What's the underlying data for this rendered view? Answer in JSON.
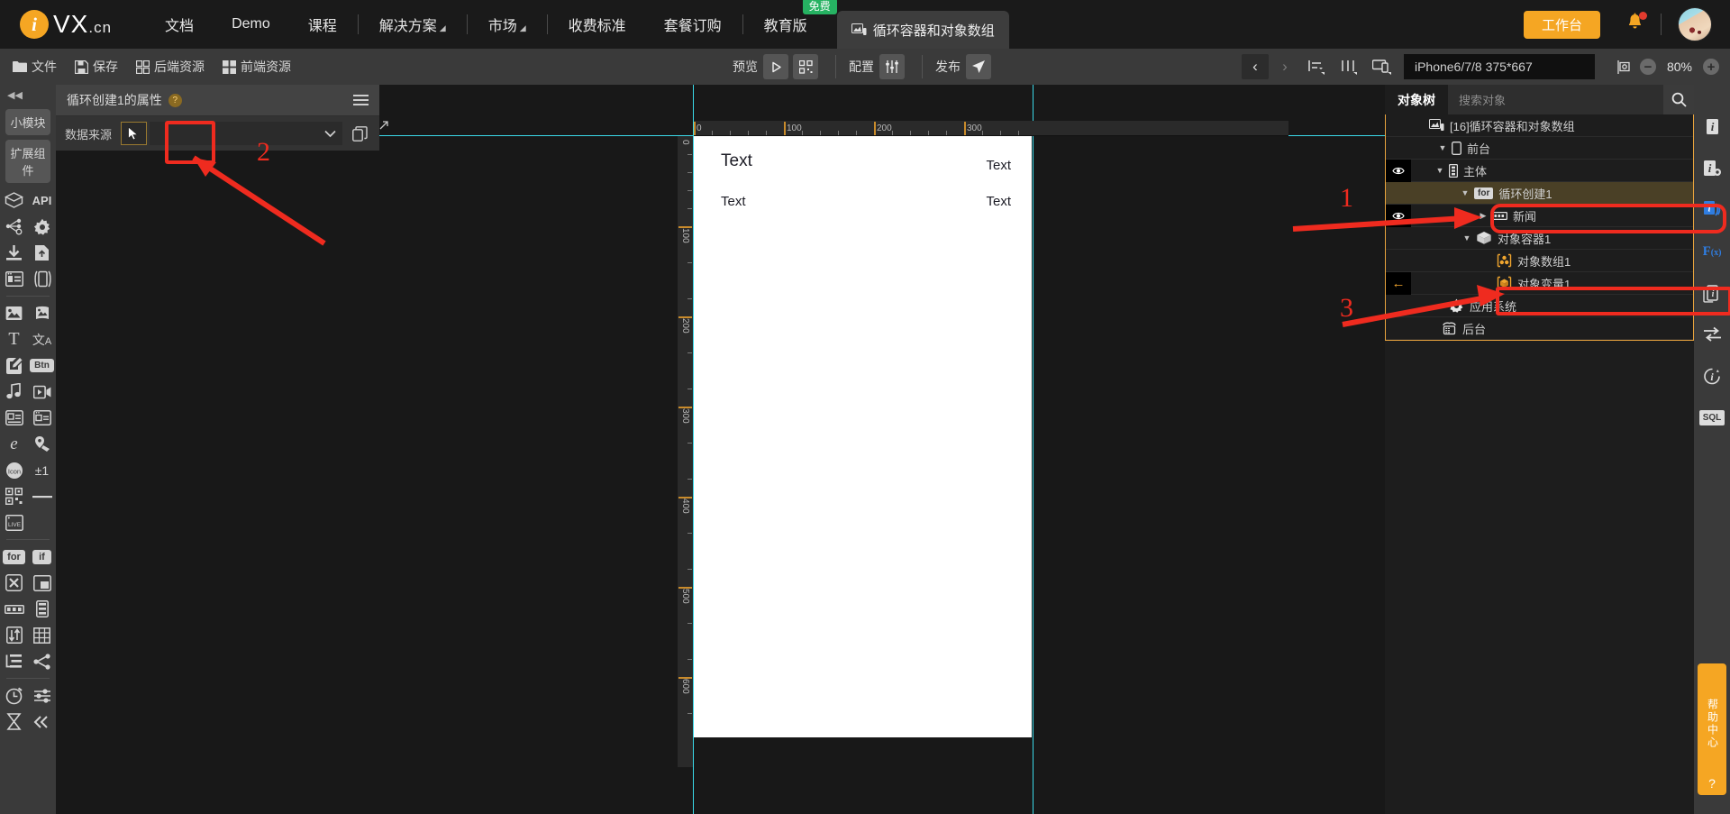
{
  "topnav": {
    "logo_mark": "i",
    "logo_name": "VX",
    "logo_suffix": ".cn",
    "items": [
      {
        "label": "文档",
        "caret": false,
        "badge": null
      },
      {
        "label": "Demo",
        "caret": false,
        "badge": null
      },
      {
        "label": "课程",
        "caret": false,
        "badge": null
      },
      {
        "label": "解决方案",
        "caret": true,
        "badge": null
      },
      {
        "label": "市场",
        "caret": true,
        "badge": null
      },
      {
        "label": "收费标准",
        "caret": false,
        "badge": null
      },
      {
        "label": "套餐订购",
        "caret": false,
        "badge": null
      },
      {
        "label": "教育版",
        "caret": false,
        "badge": "免费"
      }
    ],
    "project_tab": "循环容器和对象数组",
    "workbench_label": "工作台"
  },
  "toolbar": {
    "file_label": "文件",
    "save_label": "保存",
    "backend_res_label": "后端资源",
    "frontend_res_label": "前端资源",
    "preview_label": "预览",
    "config_label": "配置",
    "publish_label": "发布",
    "device": "iPhone6/7/8 375*667",
    "zoom": "80%"
  },
  "left_rail": {
    "collapse_icon": "double-left-arrow",
    "tags": [
      "小模块",
      "扩展组件"
    ],
    "groups": [
      {
        "icons": [
          {
            "name": "api-box-icon",
            "glyph": "box"
          },
          {
            "name": "api-text-icon",
            "glyph": "API"
          },
          {
            "name": "node-graph-icon",
            "glyph": "nodes"
          },
          {
            "name": "gear-icon",
            "glyph": "gear"
          },
          {
            "name": "download-icon",
            "glyph": "download"
          },
          {
            "name": "file-upload-icon",
            "glyph": "file-up"
          },
          {
            "name": "card-layout-icon",
            "glyph": "card"
          },
          {
            "name": "mobile-frame-icon",
            "glyph": "mobile"
          }
        ]
      },
      {
        "icons": [
          {
            "name": "image-icon",
            "glyph": "image"
          },
          {
            "name": "image-stack-icon",
            "glyph": "images"
          },
          {
            "name": "text-icon",
            "glyph": "T"
          },
          {
            "name": "translate-icon",
            "glyph": "文A"
          },
          {
            "name": "edit-icon",
            "glyph": "pencil"
          },
          {
            "name": "button-icon",
            "glyph": "Btn"
          },
          {
            "name": "audio-icon",
            "glyph": "note"
          },
          {
            "name": "video-icon",
            "glyph": "video"
          },
          {
            "name": "richtext-icon",
            "glyph": "a-list"
          },
          {
            "name": "article-icon",
            "glyph": "a-list2"
          },
          {
            "name": "browser-icon",
            "glyph": "e"
          },
          {
            "name": "map-icon",
            "glyph": "map-pin"
          },
          {
            "name": "icon-library-icon",
            "glyph": "Icon"
          },
          {
            "name": "plusminus-icon",
            "glyph": "±1"
          },
          {
            "name": "qrcode-icon",
            "glyph": "qr"
          },
          {
            "name": "line-icon",
            "glyph": "line"
          },
          {
            "name": "live-icon",
            "glyph": "LIVE"
          }
        ]
      },
      {
        "icons": [
          {
            "name": "for-loop-icon",
            "glyph": "for"
          },
          {
            "name": "if-condition-icon",
            "glyph": "if"
          },
          {
            "name": "shuffle-icon",
            "glyph": "shuffle"
          },
          {
            "name": "container-icon",
            "glyph": "container"
          },
          {
            "name": "slider-icon",
            "glyph": "slider"
          },
          {
            "name": "list-icon",
            "glyph": "list"
          },
          {
            "name": "sort-icon",
            "glyph": "sort"
          },
          {
            "name": "table-icon",
            "glyph": "table"
          },
          {
            "name": "tree-icon",
            "glyph": "tree"
          },
          {
            "name": "share-node-icon",
            "glyph": "share"
          }
        ]
      },
      {
        "icons": [
          {
            "name": "timer-icon",
            "glyph": "clock"
          },
          {
            "name": "settings-slider-icon",
            "glyph": "sliders"
          },
          {
            "name": "hourglass-icon",
            "glyph": "hourglass"
          },
          {
            "name": "collapse-left-icon",
            "glyph": "chevrons"
          }
        ]
      }
    ]
  },
  "properties": {
    "title": "循环创建1的属性",
    "help_icon": "?",
    "menu_icon": "hamburger-icon",
    "data_source_label": "数据来源",
    "data_source_value": "",
    "cursor_icon": "cursor-arrow-icon",
    "dropdown_icon": "chevron-down-icon",
    "copy_icon": "copy-icon"
  },
  "canvas": {
    "ruler_h_labels": [
      "0",
      "100",
      "200",
      "300"
    ],
    "ruler_v_labels": [
      "0",
      "100",
      "200",
      "300",
      "400",
      "500",
      "600"
    ],
    "phone_texts": [
      "Text",
      "Text",
      "Text",
      "Text"
    ]
  },
  "tree": {
    "tab_label": "对象树",
    "search_placeholder": "搜索对象",
    "search_icon": "search-icon",
    "nodes": [
      {
        "label": "[16]循环容器和对象数组",
        "indent": 0,
        "icon": "app-screen-icon",
        "eye": false,
        "twisty": "",
        "selected": false,
        "highlight": false
      },
      {
        "label": "前台",
        "indent": 1,
        "icon": "phone-icon",
        "eye": false,
        "twisty": "down",
        "selected": false,
        "highlight": false
      },
      {
        "label": "主体",
        "indent": 2,
        "icon": "body-icon",
        "eye": true,
        "twisty": "down",
        "selected": false,
        "highlight": false
      },
      {
        "label": "循环创建1",
        "indent": 3,
        "icon": "for-badge",
        "eye": false,
        "twisty": "down",
        "selected": true,
        "highlight": true
      },
      {
        "label": "新闻",
        "indent": 4,
        "icon": "data-icon",
        "eye": true,
        "twisty": "right",
        "selected": false,
        "highlight": false
      },
      {
        "label": "对象容器1",
        "indent": 3,
        "icon": "package-icon",
        "eye": false,
        "twisty": "down",
        "selected": false,
        "highlight": false
      },
      {
        "label": "对象数组1",
        "indent": 4,
        "icon": "object-array-icon",
        "eye": false,
        "twisty": "",
        "selected": false,
        "highlight": true
      },
      {
        "label": "对象变量1",
        "indent": 4,
        "icon": "object-var-icon",
        "eye": false,
        "twisty": "",
        "selected": false,
        "highlight": false,
        "back_arrow": true
      },
      {
        "label": "应用系统",
        "indent": 2,
        "icon": "gear-icon",
        "eye": false,
        "twisty": "",
        "selected": false,
        "highlight": false
      },
      {
        "label": "后台",
        "indent": 2,
        "icon": "server-icon",
        "eye": false,
        "twisty": "",
        "selected": false,
        "highlight": false
      }
    ]
  },
  "right_rail": {
    "icons": [
      {
        "name": "info-icon",
        "glyph": "i"
      },
      {
        "name": "info-settings-icon",
        "glyph": "i-gear"
      },
      {
        "name": "layers-icon",
        "glyph": "layers"
      },
      {
        "name": "function-icon",
        "glyph": "F(x)"
      },
      {
        "name": "copy-object-icon",
        "glyph": "copy"
      },
      {
        "name": "swap-icon",
        "glyph": "swap"
      },
      {
        "name": "refresh-info-icon",
        "glyph": "refresh"
      },
      {
        "name": "sql-icon",
        "glyph": "SQL"
      }
    ]
  },
  "help": {
    "text": "帮助中心",
    "question": "?"
  },
  "annotations": [
    {
      "number": "1",
      "target": "循环创建1"
    },
    {
      "number": "2",
      "target": "数据来源"
    },
    {
      "number": "3",
      "target": "对象数组1"
    }
  ]
}
